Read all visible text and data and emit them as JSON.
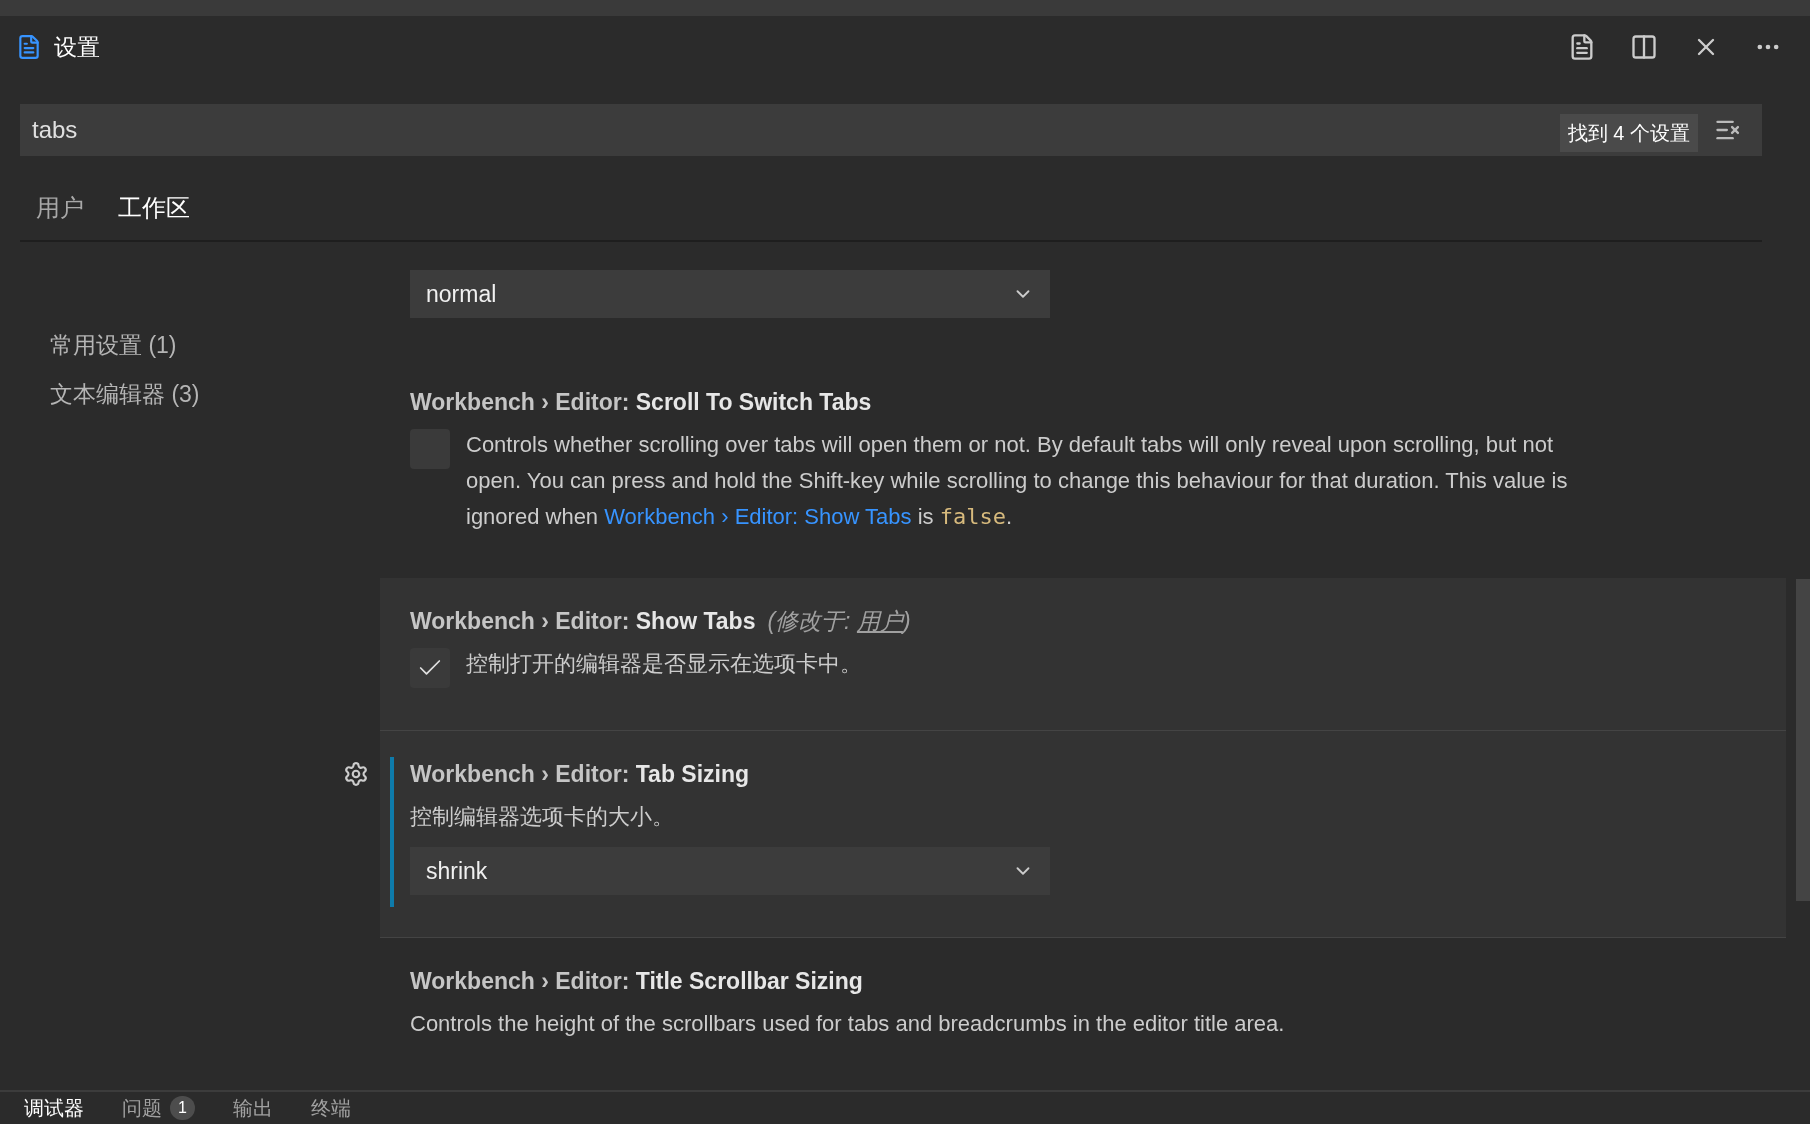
{
  "editor_tab": {
    "title": "设置"
  },
  "search": {
    "value": "tabs",
    "result_count": "找到 4 个设置"
  },
  "scope_tabs": [
    {
      "label": "用户",
      "selected": false
    },
    {
      "label": "工作区",
      "selected": true
    }
  ],
  "toc": [
    {
      "label": "常用设置 (1)"
    },
    {
      "label": "文本编辑器 (3)"
    }
  ],
  "settings": [
    {
      "kind": "select",
      "highlighted": false,
      "focused": false,
      "value": "normal"
    },
    {
      "kind": "checkbox",
      "highlighted": false,
      "focused": false,
      "category": "Workbench › Editor:",
      "name": "Scroll To Switch Tabs",
      "checked": false,
      "description": [
        {
          "kind": "text",
          "text": "Controls whether scrolling over tabs will open them or not. By default tabs will only reveal upon scrolling, but not open. You can press and hold the Shift-key while scrolling to change this behaviour for that duration. This value is ignored when "
        },
        {
          "kind": "link",
          "text": "Workbench › Editor: Show Tabs"
        },
        {
          "kind": "text",
          "text": " is "
        },
        {
          "kind": "code",
          "text": "false"
        },
        {
          "kind": "text",
          "text": "."
        }
      ]
    },
    {
      "kind": "checkbox",
      "highlighted": true,
      "focused": false,
      "category": "Workbench › Editor:",
      "name": "Show Tabs",
      "modified": {
        "prefix": "(修改于: ",
        "link": "用户",
        "suffix": ")"
      },
      "checked": true,
      "description": [
        {
          "kind": "text",
          "text": "控制打开的编辑器是否显示在选项卡中。"
        }
      ]
    },
    {
      "kind": "select",
      "highlighted": true,
      "focused": true,
      "category": "Workbench › Editor:",
      "name": "Tab Sizing",
      "description": [
        {
          "kind": "text",
          "text": "控制编辑器选项卡的大小。"
        }
      ],
      "value": "shrink"
    },
    {
      "kind": "text",
      "highlighted": false,
      "focused": false,
      "category": "Workbench › Editor:",
      "name": "Title Scrollbar Sizing",
      "description": [
        {
          "kind": "text",
          "text": "Controls the height of the scrollbars used for tabs and breadcrumbs in the editor title area."
        }
      ]
    }
  ],
  "panel_tabs": [
    {
      "label": "调试器",
      "selected": true
    },
    {
      "label": "问题",
      "badge": "1",
      "selected": false
    },
    {
      "label": "输出",
      "selected": false
    },
    {
      "label": "终端",
      "selected": false
    }
  ]
}
